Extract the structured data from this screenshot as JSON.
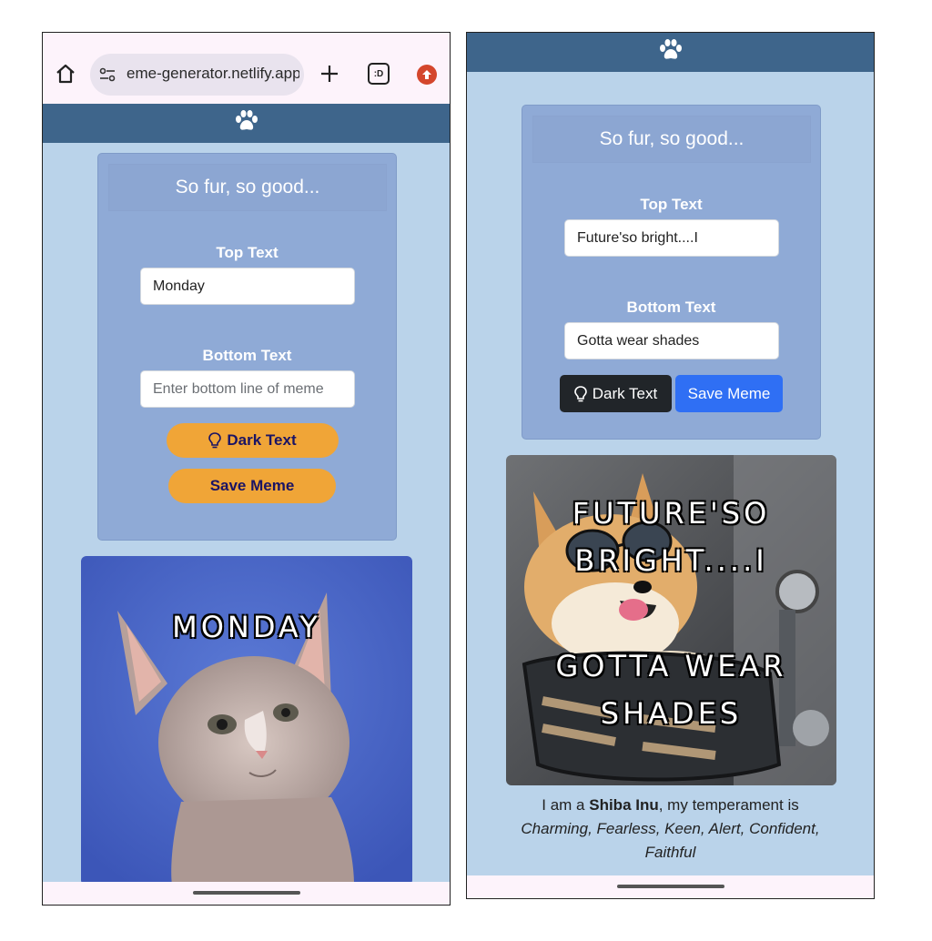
{
  "left": {
    "browser": {
      "url": "eme-generator.netlify.app",
      "tab_count": ":D",
      "icons": [
        "home-icon",
        "site-settings-icon",
        "new-tab-plus-icon",
        "tab-switcher-icon",
        "upload-extension-icon"
      ]
    },
    "navbar": {
      "icon": "paw-icon"
    },
    "form": {
      "title": "So fur, so good...",
      "top_label": "Top Text",
      "top_value": "Monday",
      "top_placeholder": "",
      "bottom_label": "Bottom Text",
      "bottom_value": "",
      "bottom_placeholder": "Enter bottom line of meme",
      "dark_text_button": "Dark Text",
      "save_button": "Save Meme"
    },
    "meme": {
      "top_text": "MONDAY",
      "image_subject": "kitten"
    }
  },
  "right": {
    "navbar": {
      "icon": "paw-icon"
    },
    "form": {
      "title": "So fur, so good...",
      "top_label": "Top Text",
      "top_value": "Future'so bright....I",
      "bottom_label": "Bottom Text",
      "bottom_value": "Gotta wear shades",
      "dark_text_button": "Dark Text",
      "save_button": "Save Meme"
    },
    "meme": {
      "top_text": "FUTURE'SO BRIGHT....I",
      "bottom_text": "GOTTA WEAR SHADES",
      "image_subject": "shiba inu"
    },
    "caption": {
      "prefix": "I am a ",
      "breed": "Shiba Inu",
      "middle": ", my temperament is",
      "temperament": "Charming, Fearless, Keen, Alert, Confident, Faithful"
    }
  },
  "colors": {
    "page_bg": "#bad3ea",
    "navbar": "#3e658b",
    "card": "#8faad6",
    "orange_button": "#f0a537",
    "dark_button": "#212529",
    "blue_button": "#2f6ff4"
  }
}
